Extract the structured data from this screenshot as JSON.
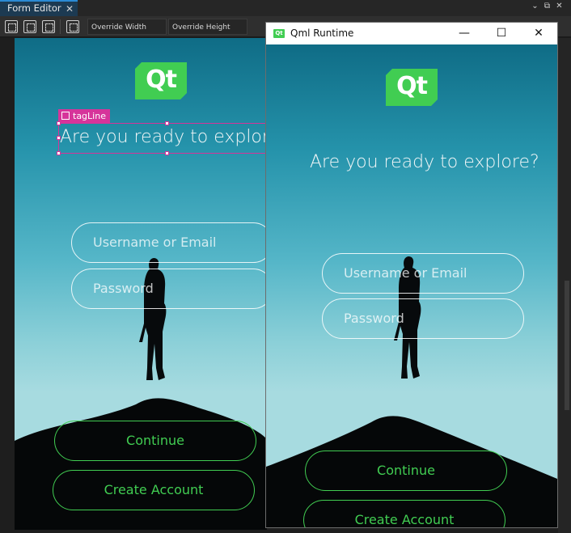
{
  "editor": {
    "tab_label": "Form Editor",
    "tab_close": "✕",
    "override_width_label": "Override Width",
    "override_height_label": "Override Height",
    "win_controls": [
      "⌄",
      "⧉",
      "✕"
    ]
  },
  "form": {
    "logo_text": "Qt",
    "selection_label": "tagLine",
    "tagline": "Are you ready to explore?",
    "username_placeholder": "Username or Email",
    "password_placeholder": "Password",
    "continue_label": "Continue",
    "create_account_label": "Create Account"
  },
  "runtime": {
    "window_title": "Qml Runtime",
    "icon_text": "Qt",
    "minimize": "—",
    "maximize": "☐",
    "close": "✕",
    "logo_text": "Qt",
    "tagline": "Are you ready to explore?",
    "username_placeholder": "Username or Email",
    "password_placeholder": "Password",
    "continue_label": "Continue",
    "create_account_label": "Create Account"
  },
  "colors": {
    "qt_green": "#41cd52",
    "selection_magenta": "#d6349a",
    "sky_top": "#0f6c86",
    "sky_bottom": "#a7dbe0"
  }
}
